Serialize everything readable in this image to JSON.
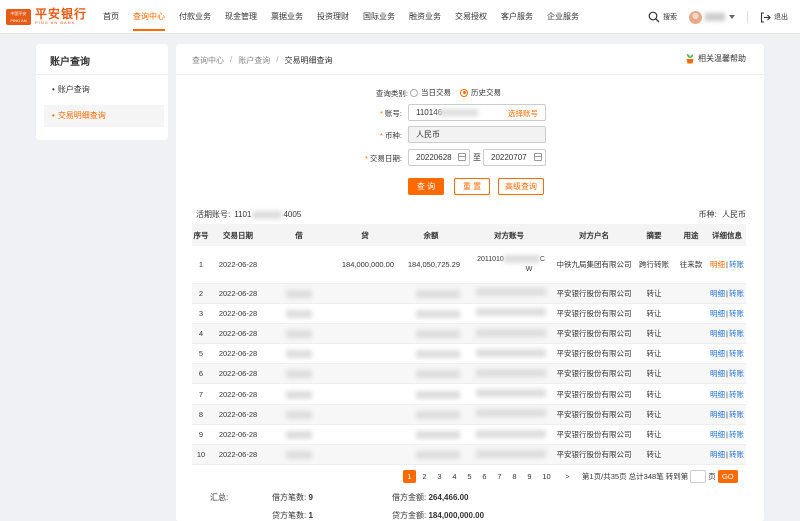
{
  "brand": {
    "badge": "中国平安\nPING AN",
    "name": "平安银行",
    "name_en": "PING AN BANK"
  },
  "nav": [
    "首页",
    "查询中心",
    "付款业务",
    "现金管理",
    "票据业务",
    "投资理财",
    "国际业务",
    "融资业务",
    "交易授权",
    "客户服务",
    "企业服务"
  ],
  "nav_active_index": 1,
  "top_right": {
    "search": "搜索",
    "logout": "退出"
  },
  "sidebar": {
    "title": "账户查询",
    "items": [
      {
        "label": "账户查询",
        "active": false
      },
      {
        "label": "交易明细查询",
        "active": true
      }
    ]
  },
  "breadcrumb": [
    "查询中心",
    "账户查询",
    "交易明细查询"
  ],
  "help_label": "相关温馨帮助",
  "form": {
    "type_label": "查询类别:",
    "type_options": [
      "当日交易",
      "历史交易"
    ],
    "type_selected": 1,
    "account_label": "账号:",
    "account_value": "110146",
    "account_link": "选择账号",
    "currency_label": "币种:",
    "currency_value": "人民币",
    "date_label": "交易日期:",
    "date_from": "20220628",
    "date_to_label": "至",
    "date_to": "20220707"
  },
  "buttons": {
    "query": "查 询",
    "reset": "重 置",
    "advanced": "高级查询"
  },
  "account_info": {
    "account_label": "活期账号:",
    "account_prefix": "1101",
    "account_suffix": "4005",
    "currency_label": "币种:",
    "currency_value": "人民币"
  },
  "table": {
    "headers": [
      "序号",
      "交易日期",
      "借",
      "贷",
      "余额",
      "对方账号",
      "对方户名",
      "摘要",
      "用途",
      "详细信息"
    ],
    "rows": [
      {
        "no": "1",
        "date": "2022-06-28",
        "debit": "",
        "credit": "184,000,000.00",
        "balance": "184,050,725.29",
        "acct": "2011010",
        "acct_tail": "C",
        "acct_line2": "W",
        "name": "中铁九局集团有限公司",
        "summary": "跨行转账",
        "purpose": "往来款"
      },
      {
        "no": "2",
        "date": "2022-06-28",
        "debit": "",
        "credit": "",
        "balance": "",
        "acct": "",
        "acct_tail": "",
        "acct_line2": "",
        "name": "平安银行股份有限公司",
        "summary": "转让",
        "purpose": ""
      },
      {
        "no": "3",
        "date": "2022-06-28",
        "debit": "",
        "credit": "",
        "balance": "",
        "acct": "",
        "acct_tail": "",
        "acct_line2": "",
        "name": "平安银行股份有限公司",
        "summary": "转让",
        "purpose": ""
      },
      {
        "no": "4",
        "date": "2022-06-28",
        "debit": "",
        "credit": "",
        "balance": "",
        "acct": "",
        "acct_tail": "",
        "acct_line2": "",
        "name": "平安银行股份有限公司",
        "summary": "转让",
        "purpose": ""
      },
      {
        "no": "5",
        "date": "2022-06-28",
        "debit": "",
        "credit": "",
        "balance": "",
        "acct": "",
        "acct_tail": "",
        "acct_line2": "",
        "name": "平安银行股份有限公司",
        "summary": "转让",
        "purpose": ""
      },
      {
        "no": "6",
        "date": "2022-06-28",
        "debit": "",
        "credit": "",
        "balance": "",
        "acct": "",
        "acct_tail": "",
        "acct_line2": "",
        "name": "平安银行股份有限公司",
        "summary": "转让",
        "purpose": ""
      },
      {
        "no": "7",
        "date": "2022-06-28",
        "debit": "",
        "credit": "",
        "balance": "",
        "acct": "",
        "acct_tail": "",
        "acct_line2": "",
        "name": "平安银行股份有限公司",
        "summary": "转让",
        "purpose": ""
      },
      {
        "no": "8",
        "date": "2022-06-28",
        "debit": "",
        "credit": "",
        "balance": "",
        "acct": "",
        "acct_tail": "",
        "acct_line2": "",
        "name": "平安银行股份有限公司",
        "summary": "转让",
        "purpose": ""
      },
      {
        "no": "9",
        "date": "2022-06-28",
        "debit": "",
        "credit": "",
        "balance": "",
        "acct": "",
        "acct_tail": "",
        "acct_line2": "",
        "name": "平安银行股份有限公司",
        "summary": "转让",
        "purpose": ""
      },
      {
        "no": "10",
        "date": "2022-06-28",
        "debit": "",
        "credit": "",
        "balance": "",
        "acct": "",
        "acct_tail": "",
        "acct_line2": "",
        "name": "平安银行股份有限公司",
        "summary": "转让",
        "purpose": ""
      }
    ],
    "detail_link": "明细",
    "transfer_link": "转账",
    "link_sep": "|"
  },
  "pager": {
    "pages": [
      "1",
      "2",
      "3",
      "4",
      "5",
      "6",
      "7",
      "8",
      "9",
      "10"
    ],
    "active": "1",
    "next": ">",
    "info": "第1页/共35页 总计348笔 转到第",
    "page_unit": "页",
    "go": "GO"
  },
  "totals": {
    "label": "汇总:",
    "debit_count_label": "借方笔数:",
    "debit_count": "9",
    "credit_count_label": "贷方笔数:",
    "credit_count": "1",
    "debit_amount_label": "借方金额:",
    "debit_amount": "264,466.00",
    "credit_amount_label": "贷方金额:",
    "credit_amount": "184,000,000.00"
  },
  "colors": {
    "accent": "#ff6a00",
    "link": "#1e6fd9"
  }
}
